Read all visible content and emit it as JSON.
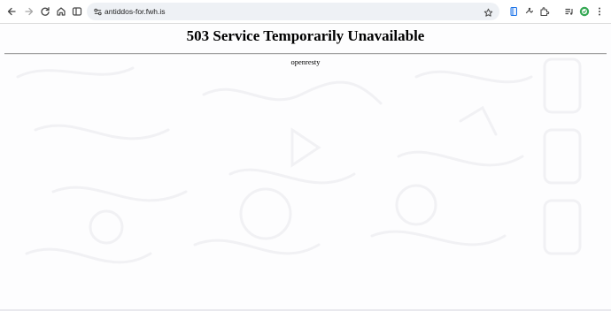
{
  "browser": {
    "url": "antiddos-for.fwh.is",
    "nav_icons": [
      "back-arrow-icon",
      "forward-arrow-icon",
      "reload-icon",
      "home-icon",
      "tab-search-icon"
    ],
    "toolbar_icons": [
      "bookmark-star-icon",
      "reading-mode-icon",
      "extension-icon",
      "puzzle-icon",
      "media-control-icon",
      "profile-avatar-icon",
      "menu-kebab-icon"
    ]
  },
  "page": {
    "heading": "503 Service Temporarily Unavailable",
    "server": "openresty"
  }
}
